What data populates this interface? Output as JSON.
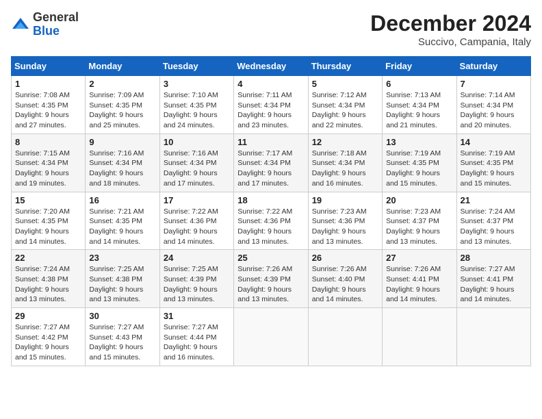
{
  "header": {
    "logo_general": "General",
    "logo_blue": "Blue",
    "title": "December 2024",
    "subtitle": "Succivo, Campania, Italy"
  },
  "weekdays": [
    "Sunday",
    "Monday",
    "Tuesday",
    "Wednesday",
    "Thursday",
    "Friday",
    "Saturday"
  ],
  "weeks": [
    [
      {
        "day": "1",
        "sunrise": "7:08 AM",
        "sunset": "4:35 PM",
        "daylight": "9 hours and 27 minutes."
      },
      {
        "day": "2",
        "sunrise": "7:09 AM",
        "sunset": "4:35 PM",
        "daylight": "9 hours and 25 minutes."
      },
      {
        "day": "3",
        "sunrise": "7:10 AM",
        "sunset": "4:35 PM",
        "daylight": "9 hours and 24 minutes."
      },
      {
        "day": "4",
        "sunrise": "7:11 AM",
        "sunset": "4:34 PM",
        "daylight": "9 hours and 23 minutes."
      },
      {
        "day": "5",
        "sunrise": "7:12 AM",
        "sunset": "4:34 PM",
        "daylight": "9 hours and 22 minutes."
      },
      {
        "day": "6",
        "sunrise": "7:13 AM",
        "sunset": "4:34 PM",
        "daylight": "9 hours and 21 minutes."
      },
      {
        "day": "7",
        "sunrise": "7:14 AM",
        "sunset": "4:34 PM",
        "daylight": "9 hours and 20 minutes."
      }
    ],
    [
      {
        "day": "8",
        "sunrise": "7:15 AM",
        "sunset": "4:34 PM",
        "daylight": "9 hours and 19 minutes."
      },
      {
        "day": "9",
        "sunrise": "7:16 AM",
        "sunset": "4:34 PM",
        "daylight": "9 hours and 18 minutes."
      },
      {
        "day": "10",
        "sunrise": "7:16 AM",
        "sunset": "4:34 PM",
        "daylight": "9 hours and 17 minutes."
      },
      {
        "day": "11",
        "sunrise": "7:17 AM",
        "sunset": "4:34 PM",
        "daylight": "9 hours and 17 minutes."
      },
      {
        "day": "12",
        "sunrise": "7:18 AM",
        "sunset": "4:34 PM",
        "daylight": "9 hours and 16 minutes."
      },
      {
        "day": "13",
        "sunrise": "7:19 AM",
        "sunset": "4:35 PM",
        "daylight": "9 hours and 15 minutes."
      },
      {
        "day": "14",
        "sunrise": "7:19 AM",
        "sunset": "4:35 PM",
        "daylight": "9 hours and 15 minutes."
      }
    ],
    [
      {
        "day": "15",
        "sunrise": "7:20 AM",
        "sunset": "4:35 PM",
        "daylight": "9 hours and 14 minutes."
      },
      {
        "day": "16",
        "sunrise": "7:21 AM",
        "sunset": "4:35 PM",
        "daylight": "9 hours and 14 minutes."
      },
      {
        "day": "17",
        "sunrise": "7:22 AM",
        "sunset": "4:36 PM",
        "daylight": "9 hours and 14 minutes."
      },
      {
        "day": "18",
        "sunrise": "7:22 AM",
        "sunset": "4:36 PM",
        "daylight": "9 hours and 13 minutes."
      },
      {
        "day": "19",
        "sunrise": "7:23 AM",
        "sunset": "4:36 PM",
        "daylight": "9 hours and 13 minutes."
      },
      {
        "day": "20",
        "sunrise": "7:23 AM",
        "sunset": "4:37 PM",
        "daylight": "9 hours and 13 minutes."
      },
      {
        "day": "21",
        "sunrise": "7:24 AM",
        "sunset": "4:37 PM",
        "daylight": "9 hours and 13 minutes."
      }
    ],
    [
      {
        "day": "22",
        "sunrise": "7:24 AM",
        "sunset": "4:38 PM",
        "daylight": "9 hours and 13 minutes."
      },
      {
        "day": "23",
        "sunrise": "7:25 AM",
        "sunset": "4:38 PM",
        "daylight": "9 hours and 13 minutes."
      },
      {
        "day": "24",
        "sunrise": "7:25 AM",
        "sunset": "4:39 PM",
        "daylight": "9 hours and 13 minutes."
      },
      {
        "day": "25",
        "sunrise": "7:26 AM",
        "sunset": "4:39 PM",
        "daylight": "9 hours and 13 minutes."
      },
      {
        "day": "26",
        "sunrise": "7:26 AM",
        "sunset": "4:40 PM",
        "daylight": "9 hours and 14 minutes."
      },
      {
        "day": "27",
        "sunrise": "7:26 AM",
        "sunset": "4:41 PM",
        "daylight": "9 hours and 14 minutes."
      },
      {
        "day": "28",
        "sunrise": "7:27 AM",
        "sunset": "4:41 PM",
        "daylight": "9 hours and 14 minutes."
      }
    ],
    [
      {
        "day": "29",
        "sunrise": "7:27 AM",
        "sunset": "4:42 PM",
        "daylight": "9 hours and 15 minutes."
      },
      {
        "day": "30",
        "sunrise": "7:27 AM",
        "sunset": "4:43 PM",
        "daylight": "9 hours and 15 minutes."
      },
      {
        "day": "31",
        "sunrise": "7:27 AM",
        "sunset": "4:44 PM",
        "daylight": "9 hours and 16 minutes."
      },
      null,
      null,
      null,
      null
    ]
  ],
  "labels": {
    "sunrise": "Sunrise:",
    "sunset": "Sunset:",
    "daylight": "Daylight:"
  }
}
